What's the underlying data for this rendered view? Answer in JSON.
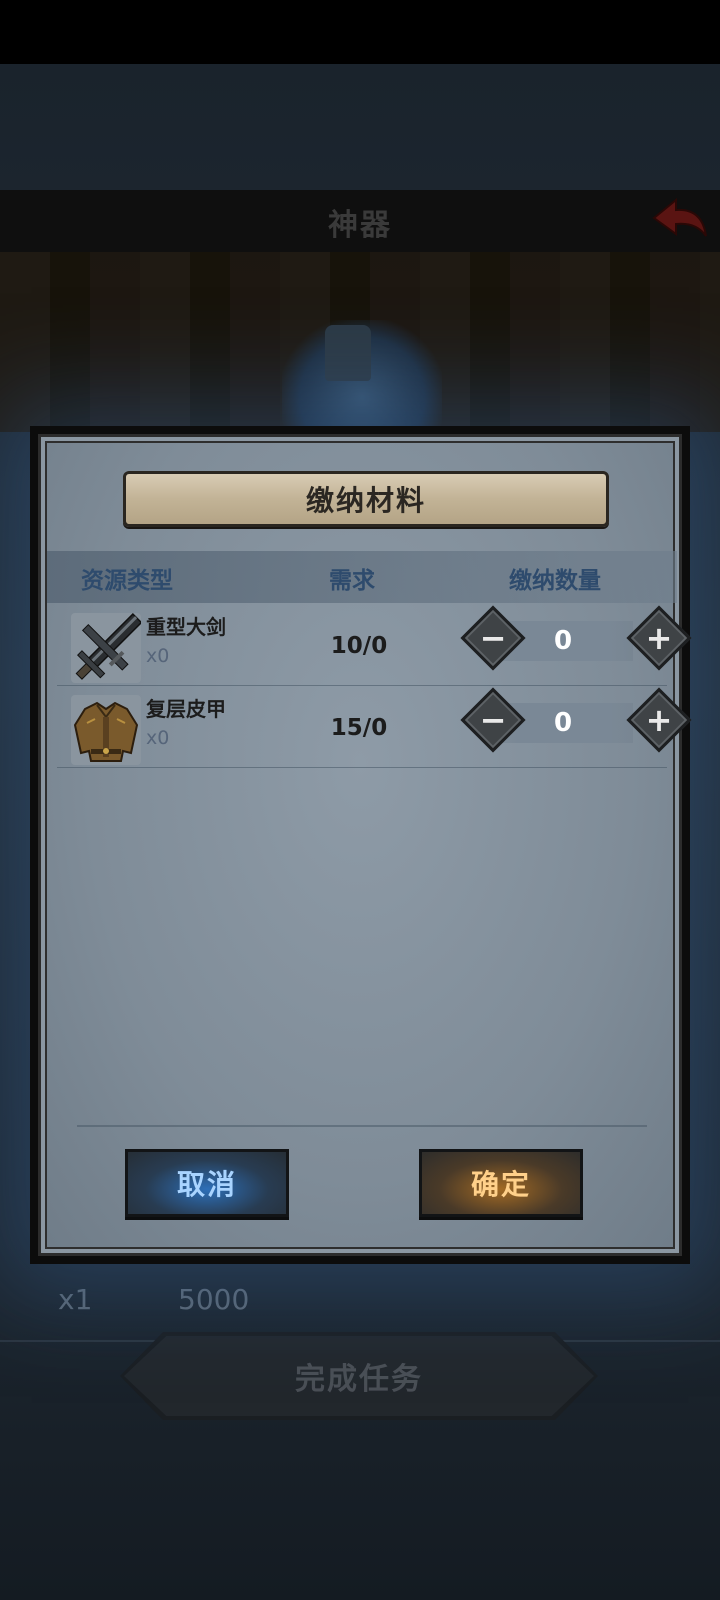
{
  "background": {
    "title": "神器",
    "reward_qty": "x1",
    "reward_gold": "5000",
    "complete_button": "完成任务"
  },
  "dialog": {
    "title": "缴纳材料",
    "headers": {
      "type": "资源类型",
      "requirement": "需求",
      "submit_qty": "缴纳数量"
    },
    "items": [
      {
        "name": "重型大剑",
        "owned": "x0",
        "requirement": "10/0",
        "quantity": "0",
        "icon": "greatsword-icon"
      },
      {
        "name": "复层皮甲",
        "owned": "x0",
        "requirement": "15/0",
        "quantity": "0",
        "icon": "leather-armor-icon"
      }
    ],
    "cancel_label": "取消",
    "confirm_label": "确定"
  },
  "colors": {
    "cancel_glow": "#2d6fb8",
    "confirm_glow": "#a26a24",
    "header_text": "#2e4b6d"
  }
}
